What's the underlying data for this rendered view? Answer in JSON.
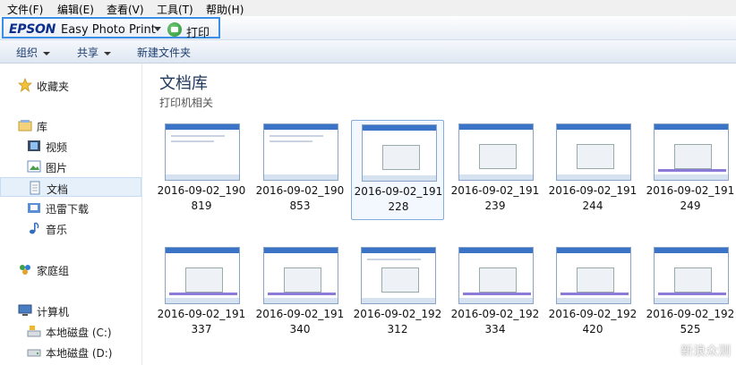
{
  "menu": [
    "文件(F)",
    "编辑(E)",
    "查看(V)",
    "工具(T)",
    "帮助(H)"
  ],
  "epson": {
    "brand": "EPSON",
    "app_name": "Easy Photo Print",
    "print_label": "打印"
  },
  "toolbar": {
    "organize": "组织",
    "share": "共享",
    "new_folder": "新建文件夹"
  },
  "sidebar": {
    "favorites": "收藏夹",
    "libraries": "库",
    "video": "视频",
    "pictures": "图片",
    "documents": "文档",
    "thunder": "迅雷下载",
    "music": "音乐",
    "homegroup": "家庭组",
    "computer": "计算机",
    "drive_c": "本地磁盘 (C:)",
    "drive_d": "本地磁盘 (D:)"
  },
  "main": {
    "title": "文档库",
    "subtitle": "打印机相关",
    "files": [
      {
        "l1": "2016-09-02_190",
        "l2": "819"
      },
      {
        "l1": "2016-09-02_190",
        "l2": "853"
      },
      {
        "l1": "2016-09-02_191",
        "l2": "228"
      },
      {
        "l1": "2016-09-02_191",
        "l2": "239"
      },
      {
        "l1": "2016-09-02_191",
        "l2": "244"
      },
      {
        "l1": "2016-09-02_191",
        "l2": "249"
      },
      {
        "l1": "2016-09-02_191",
        "l2": "337"
      },
      {
        "l1": "2016-09-02_191",
        "l2": "340"
      },
      {
        "l1": "2016-09-02_192",
        "l2": "312"
      },
      {
        "l1": "2016-09-02_192",
        "l2": "334"
      },
      {
        "l1": "2016-09-02_192",
        "l2": "420"
      },
      {
        "l1": "2016-09-02_192",
        "l2": "525"
      }
    ]
  },
  "watermark": "新浪众测"
}
